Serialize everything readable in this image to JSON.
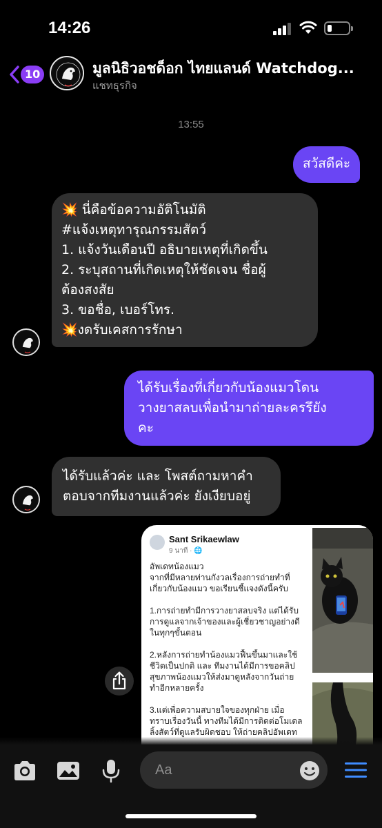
{
  "status_bar": {
    "time": "14:26"
  },
  "header": {
    "back_count": "10",
    "title": "มูลนิธิวอชด็อก ไทยแลนด์ Watchdog...",
    "subtitle": "แชทธุรกิจ"
  },
  "chat": {
    "timestamp": "13:55",
    "messages": [
      {
        "direction": "outgoing",
        "lines": [
          "สวัสดีค่ะ"
        ]
      },
      {
        "direction": "incoming",
        "lines": [
          "💥 นี่คือข้อความอัติโนมัติ",
          "#แจ้งเหตุทารุณกรรมสัตว์",
          "1. แจ้งวันเดือนปี อธิบายเหตุที่เกิดขึ้น",
          "2. ระบุสถานที่เกิดเหตุให้ชัดเจน ชื่อผู้",
          "ต้องสงสัย",
          "3. ขอชื่อ, เบอร์โทร.",
          "💥งดรับเคสการรักษา"
        ]
      },
      {
        "direction": "outgoing",
        "lines": [
          "ได้รับเรื่องที่เกี่ยวกับน้องแมวโดน",
          "วางยาสลบเพื่อนำมาถ่ายละครรึยัง",
          "คะ"
        ]
      },
      {
        "direction": "incoming",
        "lines": [
          "ได้รับแล้วค่ะ และ โพสต์ถามหาคำ",
          "ตอบจากทีมงานแล้วค่ะ ยังเงียบอยู่"
        ]
      }
    ],
    "shared_post": {
      "author": "Sant Srikaewlaw",
      "time": "9 นาที · 🌐",
      "lines": [
        "อัพเดทน้องแมว",
        "จากที่มีหลายท่านกังวลเรื่องการถ่ายทำที่",
        "เกี่ยวกับน้องแมว ขอเรียนชี้แจงดังนี้ครับ",
        "",
        "1.การถ่ายทำมีการวางยาสลบจริง แต่ได้รับ",
        "การดูแลจากเจ้าของและผู้เชี่ยวชาญอย่างดี",
        "ในทุกๆขั้นตอน",
        "",
        "2.หลังการถ่ายทำน้องแมวฟื้นขึ้นมาและใช้",
        "ชีวิตเป็นปกติ และ ทีมงานได้มีการขอคลิป",
        "สุขภาพน้องแมวให้ส่งมาดูหลังจากวันถ่าย",
        "ทำอีกหลายครั้ง",
        "",
        "3.แต่เพื่อความสบายใจของทุกฝ่าย เมื่อ",
        "ทราบเรื่องวันนี้ ทางทีมได้มีการติดต่อโมเดล",
        "ลิ้งสัตว์ที่ดูแลรับผิดชอบ ให้ถ่ายคลิปอัพเดท"
      ]
    }
  },
  "composer": {
    "placeholder": "Aa",
    "icons": [
      "camera-icon",
      "image-icon",
      "microphone-icon",
      "emoji-icon",
      "menu-icon"
    ]
  },
  "colors": {
    "outgoing_bubble": "#6a45f4",
    "incoming_bubble": "#303030",
    "accent": "#8a3df5",
    "menu_icon": "#3f8cff"
  }
}
